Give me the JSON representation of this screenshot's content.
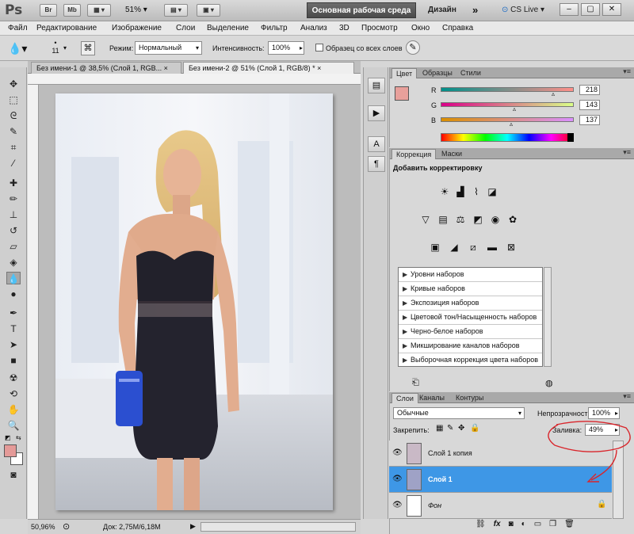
{
  "appbar": {
    "logo": "Ps",
    "br_label": "Br",
    "mb_label": "Mb",
    "zoom": "51%",
    "workspace_active": "Основная рабочая среда",
    "workspace_design": "Дизайн",
    "more": "»",
    "cslive": "CS Live"
  },
  "menu": [
    "Файл",
    "Редактирование",
    "Изображение",
    "Слои",
    "Выделение",
    "Фильтр",
    "Анализ",
    "3D",
    "Просмотр",
    "Окно",
    "Справка"
  ],
  "options": {
    "brush_size": "11",
    "mode_label": "Режим:",
    "mode_value": "Нормальный",
    "intensity_label": "Интенсивность:",
    "intensity_value": "100%",
    "sample_all_label": "Образец со всех слоев"
  },
  "tabs": [
    {
      "label": "Без имени-1 @ 38,5% (Слой 1, RGB...",
      "active": false
    },
    {
      "label": "Без имени-2 @ 51% (Слой 1, RGB/8) *",
      "active": true
    }
  ],
  "status": {
    "zoom": "50,96%",
    "doc": "Док: 2,75M/6,18M"
  },
  "color_panel": {
    "tabs": [
      "Цвет",
      "Образцы",
      "Стили"
    ],
    "r_label": "R",
    "g_label": "G",
    "b_label": "B",
    "r": "218",
    "g": "143",
    "b": "137",
    "foreground": "#da8f89"
  },
  "adjust_panel": {
    "tabs": [
      "Коррекция",
      "Маски"
    ],
    "title": "Добавить корректировку",
    "presets": [
      "Уровни наборов",
      "Кривые наборов",
      "Экспозиция наборов",
      "Цветовой тон/Насыщенность наборов",
      "Черно-белое наборов",
      "Микширование каналов наборов",
      "Выборочная коррекция цвета наборов"
    ]
  },
  "layers_panel": {
    "tabs": [
      "Слои",
      "Каналы",
      "Контуры"
    ],
    "blend_mode": "Обычные",
    "opacity_label": "Непрозрачность:",
    "opacity_value": "100%",
    "lock_label": "Закрепить:",
    "fill_label": "Заливка:",
    "fill_value": "49%",
    "layers": [
      {
        "name": "Слой 1 копия",
        "selected": false
      },
      {
        "name": "Слой 1",
        "selected": true
      },
      {
        "name": "Фон",
        "selected": false
      }
    ],
    "bottom_icons": [
      "link-icon",
      "fx-icon",
      "mask-icon",
      "adjustment-icon",
      "folder-icon",
      "new-layer-icon",
      "trash-icon"
    ]
  },
  "colors": {
    "accent_selected": "#3e97e6",
    "annotation": "#d9252b"
  }
}
